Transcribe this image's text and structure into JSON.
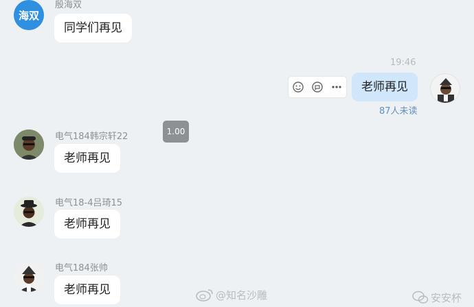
{
  "messages": [
    {
      "sender": "殷海双",
      "avatar_text": "海双",
      "text": "同学们再见"
    },
    {
      "time": "19:46",
      "text": "老师再见",
      "read_status": "87人未读"
    },
    {
      "sender": "电气184韩宗轩22",
      "text": "老师再见",
      "speed": "1.00"
    },
    {
      "sender": "电气18-4吕琦15",
      "text": "老师再见"
    },
    {
      "sender": "电气184张帅",
      "text": "老师再见"
    }
  ],
  "actions": {
    "emoji": "emoji-icon",
    "quote": "quote-icon",
    "more": "more-icon"
  },
  "watermarks": {
    "weibo": "@知名沙雕",
    "corner": "安安杯"
  }
}
